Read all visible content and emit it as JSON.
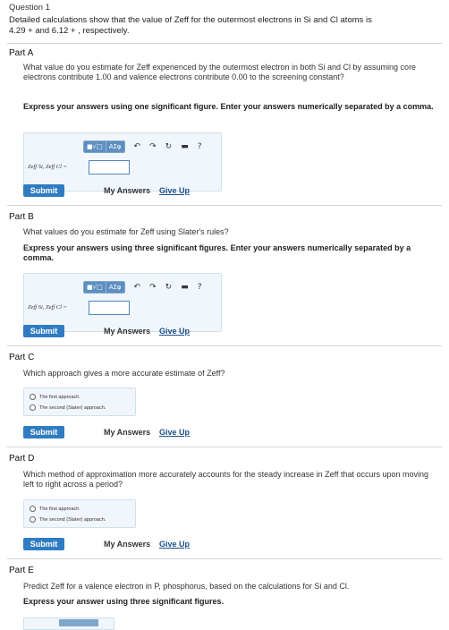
{
  "question": {
    "title": "Question 1",
    "intro_line1": "Detailed calculations show that the value of Zeff for the outermost electrons in Si and Cl atoms is",
    "intro_line2": "4.29 + and 6.12 + , respectively."
  },
  "toolbar": {
    "template_btn": "■√□",
    "greek_btn": "AΣφ",
    "undo_icon": "↶",
    "redo_icon": "↷",
    "reset_icon": "↻",
    "keyboard_icon": "▬",
    "help_icon": "?"
  },
  "actions": {
    "submit": "Submit",
    "my_answers": "My Answers",
    "give_up": "Give Up"
  },
  "parts": {
    "a": {
      "title": "Part A",
      "prompt": "What value do you estimate for Zeff experienced by the outermost electron in both Si and Cl by assuming core electrons contribute 1.00 and valence electrons contribute 0.00 to the screening constant?",
      "instruction": "Express your answers using one significant figure. Enter your answers numerically separated by a comma.",
      "answer_label": "Zeff Si, Zeff Cl =",
      "answer_value": ""
    },
    "b": {
      "title": "Part B",
      "prompt": "What values do you estimate for Zeff using Slater's rules?",
      "instruction": "Express your answers using three significant figures. Enter your answers numerically separated by a comma.",
      "answer_label": "Zeff Si, Zeff Cl =",
      "answer_value": ""
    },
    "c": {
      "title": "Part C",
      "prompt": "Which approach gives a more accurate estimate of Zeff?",
      "options": [
        "The first approach.",
        "The second (Slater) approach."
      ]
    },
    "d": {
      "title": "Part D",
      "prompt": "Which method of approximation more accurately accounts for the steady increase in Zeff that occurs upon moving left to right across a period?",
      "options": [
        "The first approach.",
        "The second (Slater) approach."
      ]
    },
    "e": {
      "title": "Part E",
      "prompt": "Predict Zeff for a valence electron in P, phosphorus, based on the calculations for Si and Cl.",
      "instruction": "Express your answer using three significant figures."
    }
  }
}
